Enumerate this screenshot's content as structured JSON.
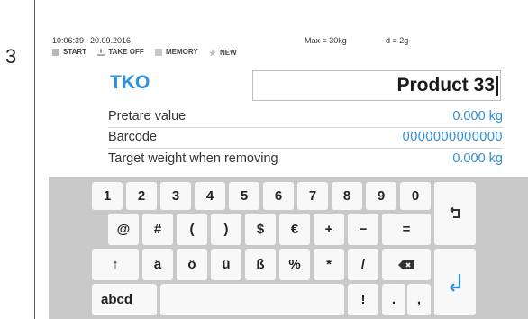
{
  "step_number": "3",
  "status": {
    "time": "10:06:39",
    "date": "20.09.2016",
    "max": "Max = 30kg",
    "d": "d = 2g"
  },
  "menu": [
    {
      "label": "START",
      "icon": "start-icon"
    },
    {
      "label": "TAKE OFF",
      "icon": "tare-icon"
    },
    {
      "label": "MEMORY",
      "icon": "memory-icon"
    },
    {
      "label": "NEW",
      "icon": "star-icon"
    }
  ],
  "header": {
    "title": "TKO",
    "product_value": "Product 33"
  },
  "fields": [
    {
      "label": "Pretare value",
      "value": "0.000",
      "unit": "kg"
    },
    {
      "label": "Barcode",
      "value": "0000000000000",
      "unit": ""
    },
    {
      "label": "Target weight when removing",
      "value": "0.000",
      "unit": "kg"
    }
  ],
  "keyboard": {
    "row1": [
      "1",
      "2",
      "3",
      "4",
      "5",
      "6",
      "7",
      "8",
      "9",
      "0"
    ],
    "row2": [
      "@",
      "#",
      "(",
      ")",
      "$",
      "€",
      "+",
      "−",
      "="
    ],
    "row3": [
      "↑",
      "ä",
      "ö",
      "ü",
      "ß",
      "%",
      "*",
      "/"
    ],
    "row4": [
      "abcd",
      "!",
      ".",
      ","
    ],
    "backspace_icon": "backspace-icon",
    "undo_icon": "undo-arrow-icon",
    "enter_icon": "enter-icon"
  },
  "colors": {
    "accent": "#2f8fd8",
    "keyboard_bg": "#c9c9c9",
    "key_bg": "#f8f8f8"
  }
}
